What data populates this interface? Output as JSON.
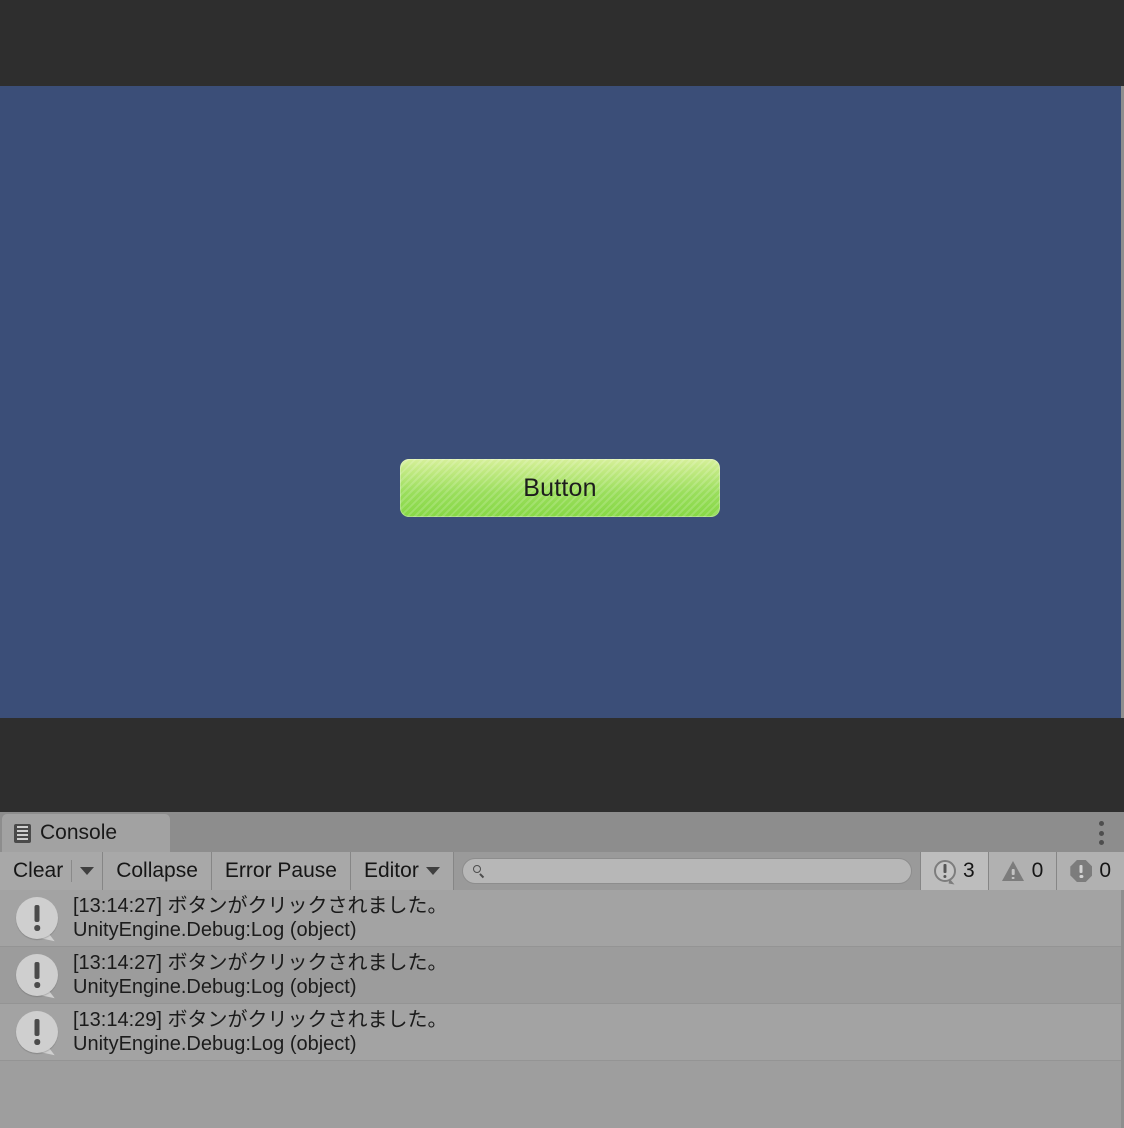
{
  "game_view": {
    "background_color": "#3b4e78",
    "chrome_color": "#2e2e2e",
    "button": {
      "label": "Button",
      "color_top": "#d6f09a",
      "color_bottom": "#86d845",
      "text_color": "#1d1d1d"
    }
  },
  "console": {
    "tab": {
      "label": "Console",
      "icon": "console-lines-icon"
    },
    "window_menu_icon": "kebab-menu-icon",
    "toolbar": {
      "clear_label": "Clear",
      "clear_dropdown_icon": "chevron-down-icon",
      "collapse_label": "Collapse",
      "error_pause_label": "Error Pause",
      "editor_label": "Editor",
      "editor_dropdown_icon": "chevron-down-icon",
      "search": {
        "value": "",
        "placeholder": "",
        "icon": "search-icon"
      },
      "counters": {
        "info": {
          "icon": "info-bubble-icon",
          "count": "3"
        },
        "warning": {
          "icon": "warning-triangle-icon",
          "count": "0"
        },
        "error": {
          "icon": "error-octagon-icon",
          "count": "0"
        }
      }
    },
    "entries": [
      {
        "icon": "info-bubble-icon",
        "message": "[13:14:27] ボタンがクリックされました。",
        "stack": "UnityEngine.Debug:Log (object)"
      },
      {
        "icon": "info-bubble-icon",
        "message": "[13:14:27] ボタンがクリックされました。",
        "stack": "UnityEngine.Debug:Log (object)"
      },
      {
        "icon": "info-bubble-icon",
        "message": "[13:14:29] ボタンがクリックされました。",
        "stack": "UnityEngine.Debug:Log (object)"
      }
    ]
  }
}
